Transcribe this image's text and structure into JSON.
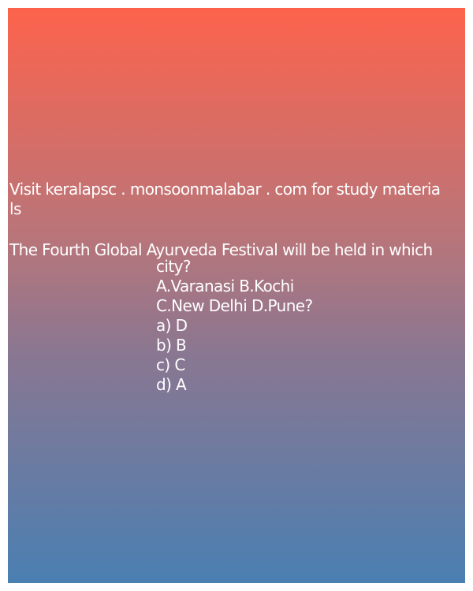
{
  "card": {
    "gradient": [
      "#fd634c",
      "#4a7fb2"
    ],
    "promo_line1": "Visit keralapsc . monsoonmalabar . com for study materia",
    "promo_line2": "ls",
    "question_line1": "The Fourth Global Ayurveda Festival will be held in which",
    "question_line2": "city?",
    "options_line1": "A.Varanasi B.Kochi",
    "options_line2": "C.New Delhi D.Pune?",
    "answers": [
      "a) D",
      "b) B",
      "c) C",
      "d) A"
    ]
  }
}
